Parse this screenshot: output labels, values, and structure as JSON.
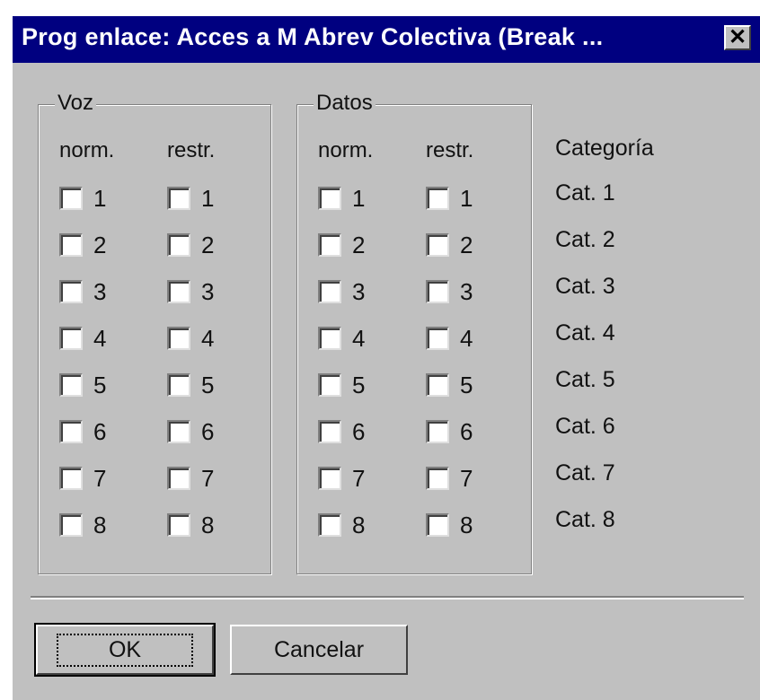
{
  "window": {
    "title": "Prog enlace: Acces a M Abrev Colectiva (Break ...",
    "close_glyph": "✕"
  },
  "voz": {
    "label": "Voz",
    "col_norm": "norm.",
    "col_restr": "restr."
  },
  "datos": {
    "label": "Datos",
    "col_norm": "norm.",
    "col_restr": "restr."
  },
  "checkbox_numbers": [
    "1",
    "2",
    "3",
    "4",
    "5",
    "6",
    "7",
    "8"
  ],
  "categoria": {
    "header": "Categoría",
    "items": [
      "Cat. 1",
      "Cat. 2",
      "Cat. 3",
      "Cat. 4",
      "Cat. 5",
      "Cat. 6",
      "Cat. 7",
      "Cat. 8"
    ]
  },
  "buttons": {
    "ok": "OK",
    "cancel": "Cancelar"
  }
}
